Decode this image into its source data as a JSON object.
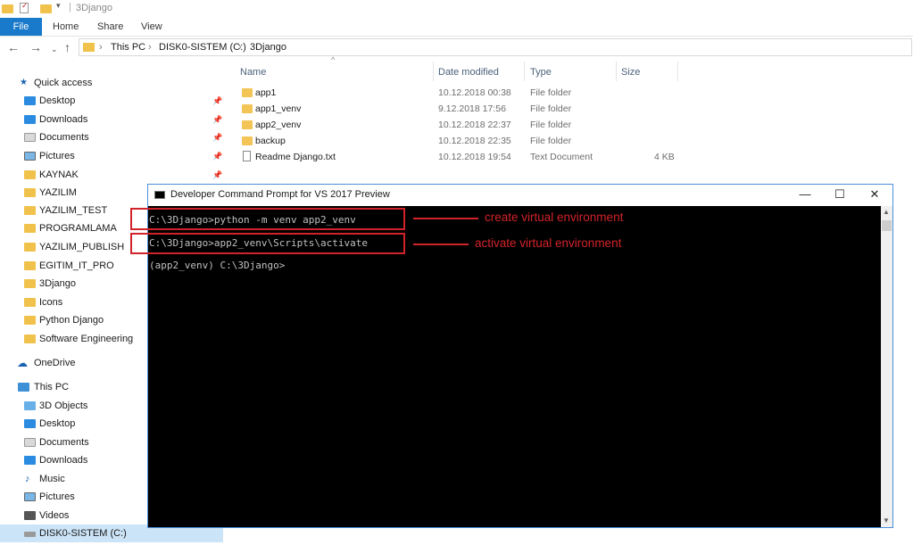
{
  "titlebar": {
    "title": "3Django"
  },
  "ribbon": {
    "file": "File",
    "home": "Home",
    "share": "Share",
    "view": "View"
  },
  "address": {
    "crumbs": [
      "This PC",
      "DISK0-SISTEM (C:)",
      "3Django"
    ]
  },
  "columns": {
    "name": "Name",
    "date": "Date modified",
    "type": "Type",
    "size": "Size"
  },
  "files": [
    {
      "name": "app1",
      "date": "10.12.2018 00:38",
      "type": "File folder",
      "size": ""
    },
    {
      "name": "app1_venv",
      "date": "9.12.2018 17:56",
      "type": "File folder",
      "size": ""
    },
    {
      "name": "app2_venv",
      "date": "10.12.2018 22:37",
      "type": "File folder",
      "size": ""
    },
    {
      "name": "backup",
      "date": "10.12.2018 22:35",
      "type": "File folder",
      "size": ""
    },
    {
      "name": "Readme Django.txt",
      "date": "10.12.2018 19:54",
      "type": "Text Document",
      "size": "4 KB"
    }
  ],
  "sidebar": {
    "quick_access": "Quick access",
    "qa_items": [
      "Desktop",
      "Downloads",
      "Documents",
      "Pictures",
      "KAYNAK",
      "YAZILIM",
      "YAZILIM_TEST",
      "PROGRAMLAMA",
      "YAZILIM_PUBLISH",
      "EGITIM_IT_PRO",
      "3Django",
      "Icons",
      "Python Django",
      "Software Engineering"
    ],
    "onedrive": "OneDrive",
    "this_pc": "This PC",
    "pc_items": [
      "3D Objects",
      "Desktop",
      "Documents",
      "Downloads",
      "Music",
      "Pictures",
      "Videos",
      "DISK0-SISTEM (C:)"
    ]
  },
  "cmd": {
    "title": "Developer Command Prompt for VS 2017 Preview",
    "lines": [
      "C:\\3Django>python -m venv app2_venv",
      "C:\\3Django>app2_venv\\Scripts\\activate",
      "(app2_venv) C:\\3Django>"
    ],
    "annotations": [
      "create virtual environment",
      "activate virtual environment"
    ]
  }
}
